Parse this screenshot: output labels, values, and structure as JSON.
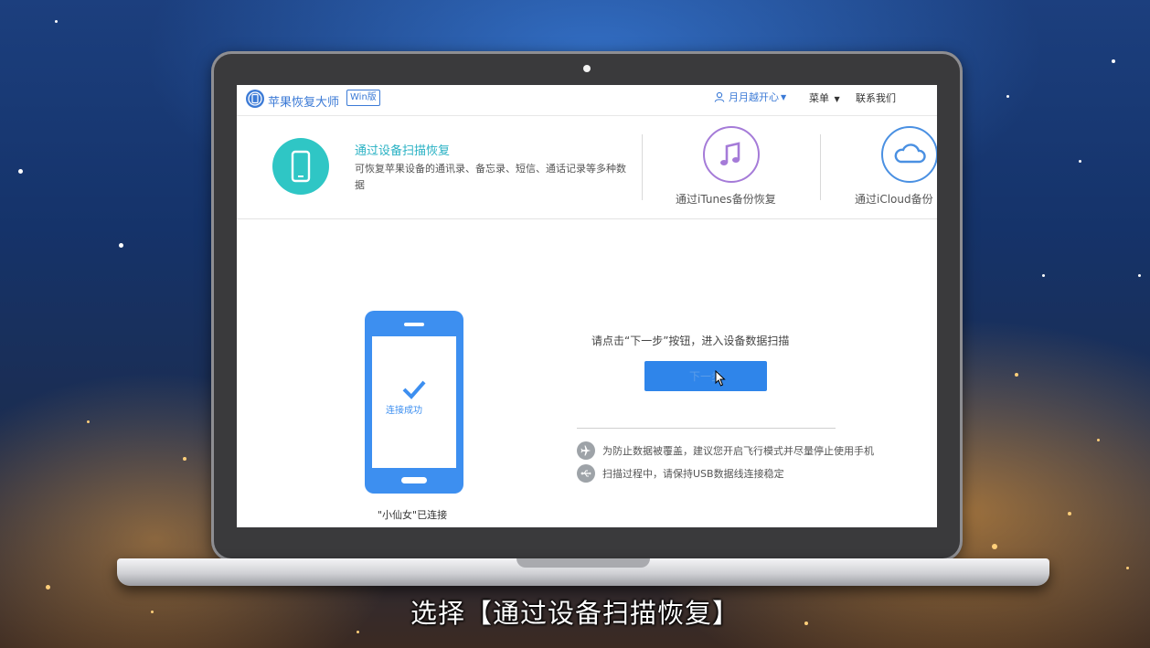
{
  "app": {
    "title": "苹果恢复大师",
    "edition_badge": "Win版",
    "user_name": "月月越开心",
    "menu_label": "菜单",
    "contact_label": "联系我们"
  },
  "modes": {
    "device": {
      "title": "通过设备扫描恢复",
      "description": "可恢复苹果设备的通讯录、备忘录、短信、通话记录等多种数据"
    },
    "itunes": {
      "label": "通过iTunes备份恢复"
    },
    "icloud": {
      "label": "通过iCloud备份"
    }
  },
  "main": {
    "phone_status": "连接成功",
    "connected_name": "\"小仙女\"已连接",
    "instruction": "请点击“下一步”按钮，进入设备数据扫描",
    "next_button": "下一步",
    "tips": [
      {
        "icon": "airplane-icon",
        "text": "为防止数据被覆盖，建议您开启飞行模式并尽量停止使用手机"
      },
      {
        "icon": "usb-icon",
        "text": "扫描过程中，请保持USB数据线连接稳定"
      }
    ]
  },
  "subtitle": "选择【通过设备扫描恢复】",
  "colors": {
    "brand_blue": "#3b7ad6",
    "device_teal": "#2fc6c5",
    "itunes_purple": "#a57bd8",
    "button_blue": "#2f85ea",
    "phone_blue": "#3d8ff0"
  }
}
